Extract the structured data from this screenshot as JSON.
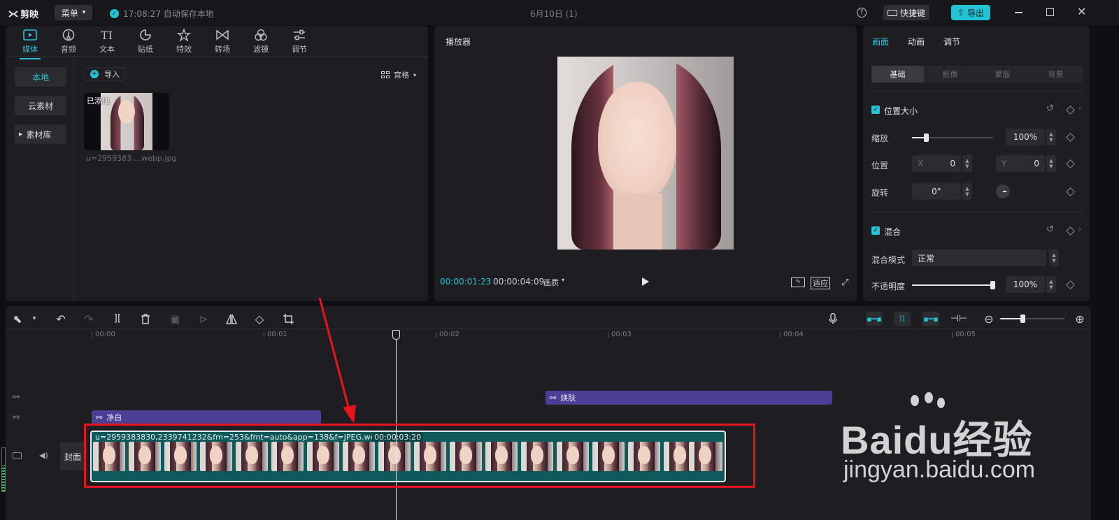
{
  "app": {
    "name": "剪映",
    "menu_label": "菜单",
    "autosave": "17:08:27 自动保存本地",
    "project_title": "6月10日 (1)",
    "shortcut_label": "快捷键",
    "export_label": "导出"
  },
  "media_tabs": [
    {
      "label": "媒体",
      "icon": "media-icon",
      "active": true
    },
    {
      "label": "音频",
      "icon": "audio-icon"
    },
    {
      "label": "文本",
      "icon": "text-icon"
    },
    {
      "label": "贴纸",
      "icon": "sticker-icon"
    },
    {
      "label": "特效",
      "icon": "effects-icon"
    },
    {
      "label": "转场",
      "icon": "transition-icon"
    },
    {
      "label": "滤镜",
      "icon": "filter-icon"
    },
    {
      "label": "调节",
      "icon": "adjust-icon"
    }
  ],
  "media_sidebar": [
    "本地",
    "云素材",
    "素材库"
  ],
  "media_pane": {
    "import_label": "导入",
    "view_label": "宫格",
    "added_badge": "已添加",
    "filename": "u=2959383....webp.jpg"
  },
  "player": {
    "title": "播放器",
    "current_time": "00:00:01:23",
    "total_time": "00:00:04:09",
    "quality_label": "画质",
    "fit_label": "适应"
  },
  "inspector": {
    "tabs": [
      "画面",
      "动画",
      "调节"
    ],
    "subtabs": [
      "基础",
      "抠像",
      "蒙版",
      "背景"
    ],
    "section_position": "位置大小",
    "scale_label": "缩放",
    "scale_value": "100%",
    "scale_fraction": 0.18,
    "position_label": "位置",
    "x_label": "X",
    "x_value": "0",
    "y_label": "Y",
    "y_value": "0",
    "rotate_label": "旋转",
    "rotate_value": "0°",
    "section_blend": "混合",
    "blend_mode_label": "混合模式",
    "blend_mode_value": "正常",
    "opacity_label": "不透明度",
    "opacity_value": "100%",
    "opacity_fraction": 1.0
  },
  "timeline": {
    "ruler": [
      "00:00",
      "00:01",
      "00:02",
      "00:03",
      "00:04",
      "00:05"
    ],
    "effect_clip_1": "焕肤",
    "effect_clip_2": "净白",
    "video_clip_name": "u=2959383830,2339741232&fm=253&fmt=auto&app=138&f=JPEG.webp.jpg",
    "video_clip_duration": "00:00:03:20",
    "cover_label": "封面"
  },
  "watermark": {
    "brand": "Baidu经验",
    "url": "jingyan.baidu.com"
  },
  "colors": {
    "accent": "#23c3d4",
    "annotation": "#e8141b",
    "effect_clip": "#4a3f94",
    "video_clip": "#0e5a5a"
  }
}
